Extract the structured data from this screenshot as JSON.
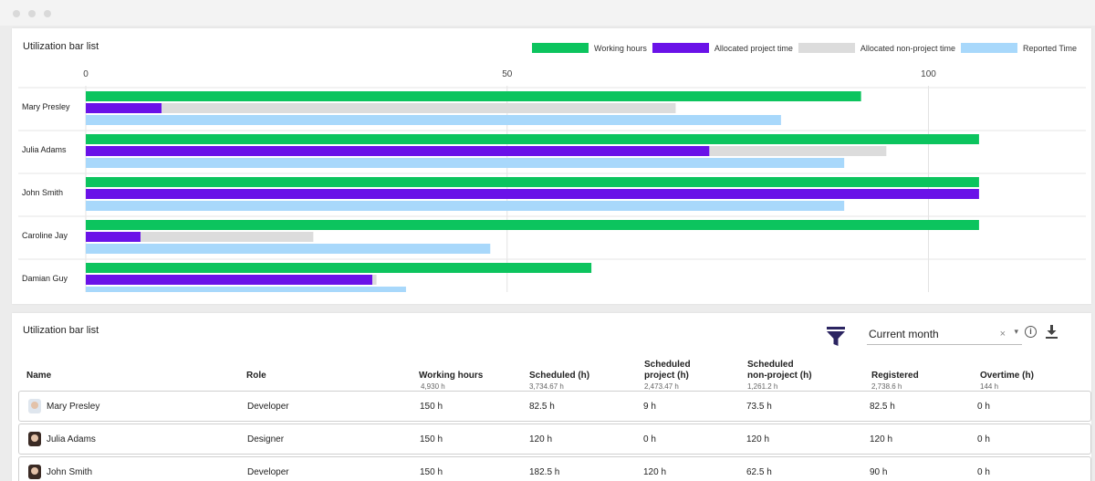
{
  "chart_card": {
    "title": "Utilization bar list"
  },
  "legend": [
    {
      "label": "Working hours",
      "color": "#0cc45e"
    },
    {
      "label": "Allocated project time",
      "color": "#6a12e8"
    },
    {
      "label": "Allocated non-project time",
      "color": "#dcdcdc"
    },
    {
      "label": "Reported Time",
      "color": "#a8d8fb"
    }
  ],
  "chart_data": {
    "type": "bar",
    "orientation": "horizontal",
    "title": "Utilization bar list",
    "categories": [
      "Mary Presley",
      "Julia Adams",
      "John Smith",
      "Caroline Jay",
      "Damian Guy"
    ],
    "x_ticks": [
      0,
      50,
      100
    ],
    "xlim": [
      0,
      120
    ],
    "grid": true,
    "legend_position": "top-right",
    "series": [
      {
        "name": "Working hours",
        "color": "#0cc45e",
        "values": [
          92,
          106,
          106,
          106,
          60
        ]
      },
      {
        "name": "Allocated project time",
        "color": "#6a12e8",
        "values": [
          9,
          74,
          106,
          6.5,
          34
        ]
      },
      {
        "name": "Allocated non-project time",
        "color": "#dcdcdc",
        "values": [
          61,
          21,
          0,
          20.5,
          0.5
        ],
        "stacked_on": "Allocated project time"
      },
      {
        "name": "Reported Time",
        "color": "#a8d8fb",
        "values": [
          82.5,
          90,
          90,
          48,
          38
        ]
      }
    ]
  },
  "table_card": {
    "title": "Utilization bar list",
    "period_select": {
      "value": "Current month",
      "clear": "×",
      "caret": "▾"
    },
    "info": "i",
    "columns": [
      {
        "label": "Name",
        "sub": ""
      },
      {
        "label": "Role",
        "sub": ""
      },
      {
        "label": "Working hours",
        "sub": "4,930 h"
      },
      {
        "label": "Scheduled (h)",
        "sub": "3,734.67 h"
      },
      {
        "label_lines": [
          "Scheduled",
          "project (h)"
        ],
        "sub": "2,473.47 h"
      },
      {
        "label_lines": [
          "Scheduled",
          "non-project (h)"
        ],
        "sub": "1,261.2 h"
      },
      {
        "label": "Registered",
        "sub": "2,738.6 h"
      },
      {
        "label": "Overtime (h)",
        "sub": "144 h"
      }
    ],
    "rows": [
      {
        "name": "Mary Presley",
        "role": "Developer",
        "working": "150 h",
        "scheduled": "82.5 h",
        "sched_project": "9 h",
        "sched_nonproject": "73.5 h",
        "registered": "82.5 h",
        "overtime": "0 h"
      },
      {
        "name": "Julia Adams",
        "role": "Designer",
        "working": "150 h",
        "scheduled": "120 h",
        "sched_project": "0 h",
        "sched_nonproject": "120 h",
        "registered": "120 h",
        "overtime": "0 h"
      },
      {
        "name": "John Smith",
        "role": "Developer",
        "working": "150 h",
        "scheduled": "182.5 h",
        "sched_project": "120 h",
        "sched_nonproject": "62.5 h",
        "registered": "90 h",
        "overtime": "0 h"
      }
    ]
  }
}
